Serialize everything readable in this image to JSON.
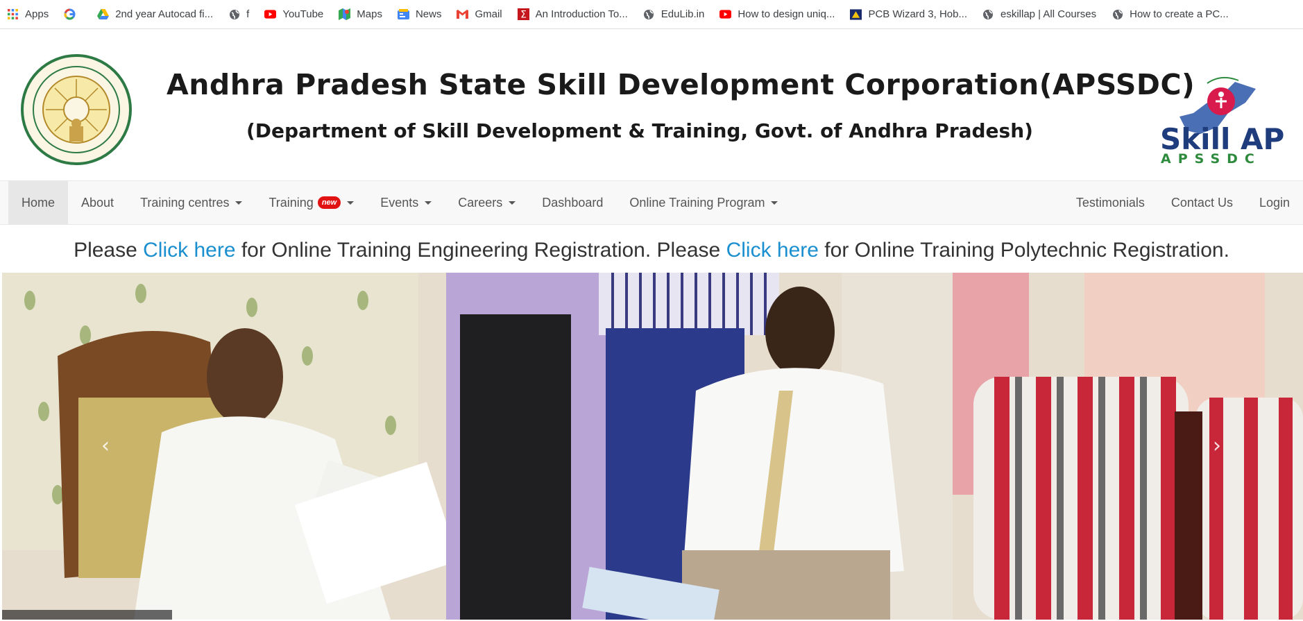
{
  "bookmarks": [
    {
      "label": "Apps",
      "icon": "apps-grid-icon"
    },
    {
      "label": "",
      "icon": "google-icon"
    },
    {
      "label": "2nd year Autocad fi...",
      "icon": "google-drive-icon"
    },
    {
      "label": "f",
      "icon": "globe-icon"
    },
    {
      "label": "YouTube",
      "icon": "youtube-icon"
    },
    {
      "label": "Maps",
      "icon": "maps-icon"
    },
    {
      "label": "News",
      "icon": "news-icon"
    },
    {
      "label": "Gmail",
      "icon": "gmail-icon"
    },
    {
      "label": "An Introduction To...",
      "icon": "sigma-icon"
    },
    {
      "label": "EduLib.in",
      "icon": "globe-icon"
    },
    {
      "label": "How to design uniq...",
      "icon": "youtube-icon"
    },
    {
      "label": "PCB Wizard 3, Hob...",
      "icon": "pcb-icon"
    },
    {
      "label": "eskillap | All Courses",
      "icon": "globe-icon"
    },
    {
      "label": "How to create a PC...",
      "icon": "globe-icon"
    }
  ],
  "header": {
    "title": "Andhra Pradesh State Skill Development Corporation(APSSDC)",
    "subtitle": "(Department of Skill Development & Training, Govt. of Andhra Pradesh)",
    "logo_word": "Skill AP",
    "logo_sub": "APSSDC"
  },
  "nav": {
    "left": [
      {
        "label": "Home",
        "active": true
      },
      {
        "label": "About"
      },
      {
        "label": "Training centres",
        "dropdown": true
      },
      {
        "label": "Training",
        "badge": "new",
        "dropdown": true
      },
      {
        "label": "Events",
        "dropdown": true
      },
      {
        "label": "Careers",
        "dropdown": true
      },
      {
        "label": "Dashboard"
      },
      {
        "label": "Online Training Program",
        "dropdown": true
      }
    ],
    "right": [
      {
        "label": "Testimonials"
      },
      {
        "label": "Contact Us"
      },
      {
        "label": "Login"
      }
    ]
  },
  "registration": {
    "please1": "Please ",
    "link1": "Click here",
    "text1": " for Online Training Engineering Registration. Please ",
    "link2": "Click here",
    "text2": " for Online Training Polytechnic Registration."
  },
  "carousel": {
    "prev": "‹",
    "next": "›"
  },
  "colors": {
    "link": "#1a8fd0",
    "badge": "#e01212",
    "nav_bg": "#f8f8f8",
    "title": "#1a1a1a",
    "logo_blue": "#1f3c7c",
    "logo_green": "#2e8b3e"
  }
}
